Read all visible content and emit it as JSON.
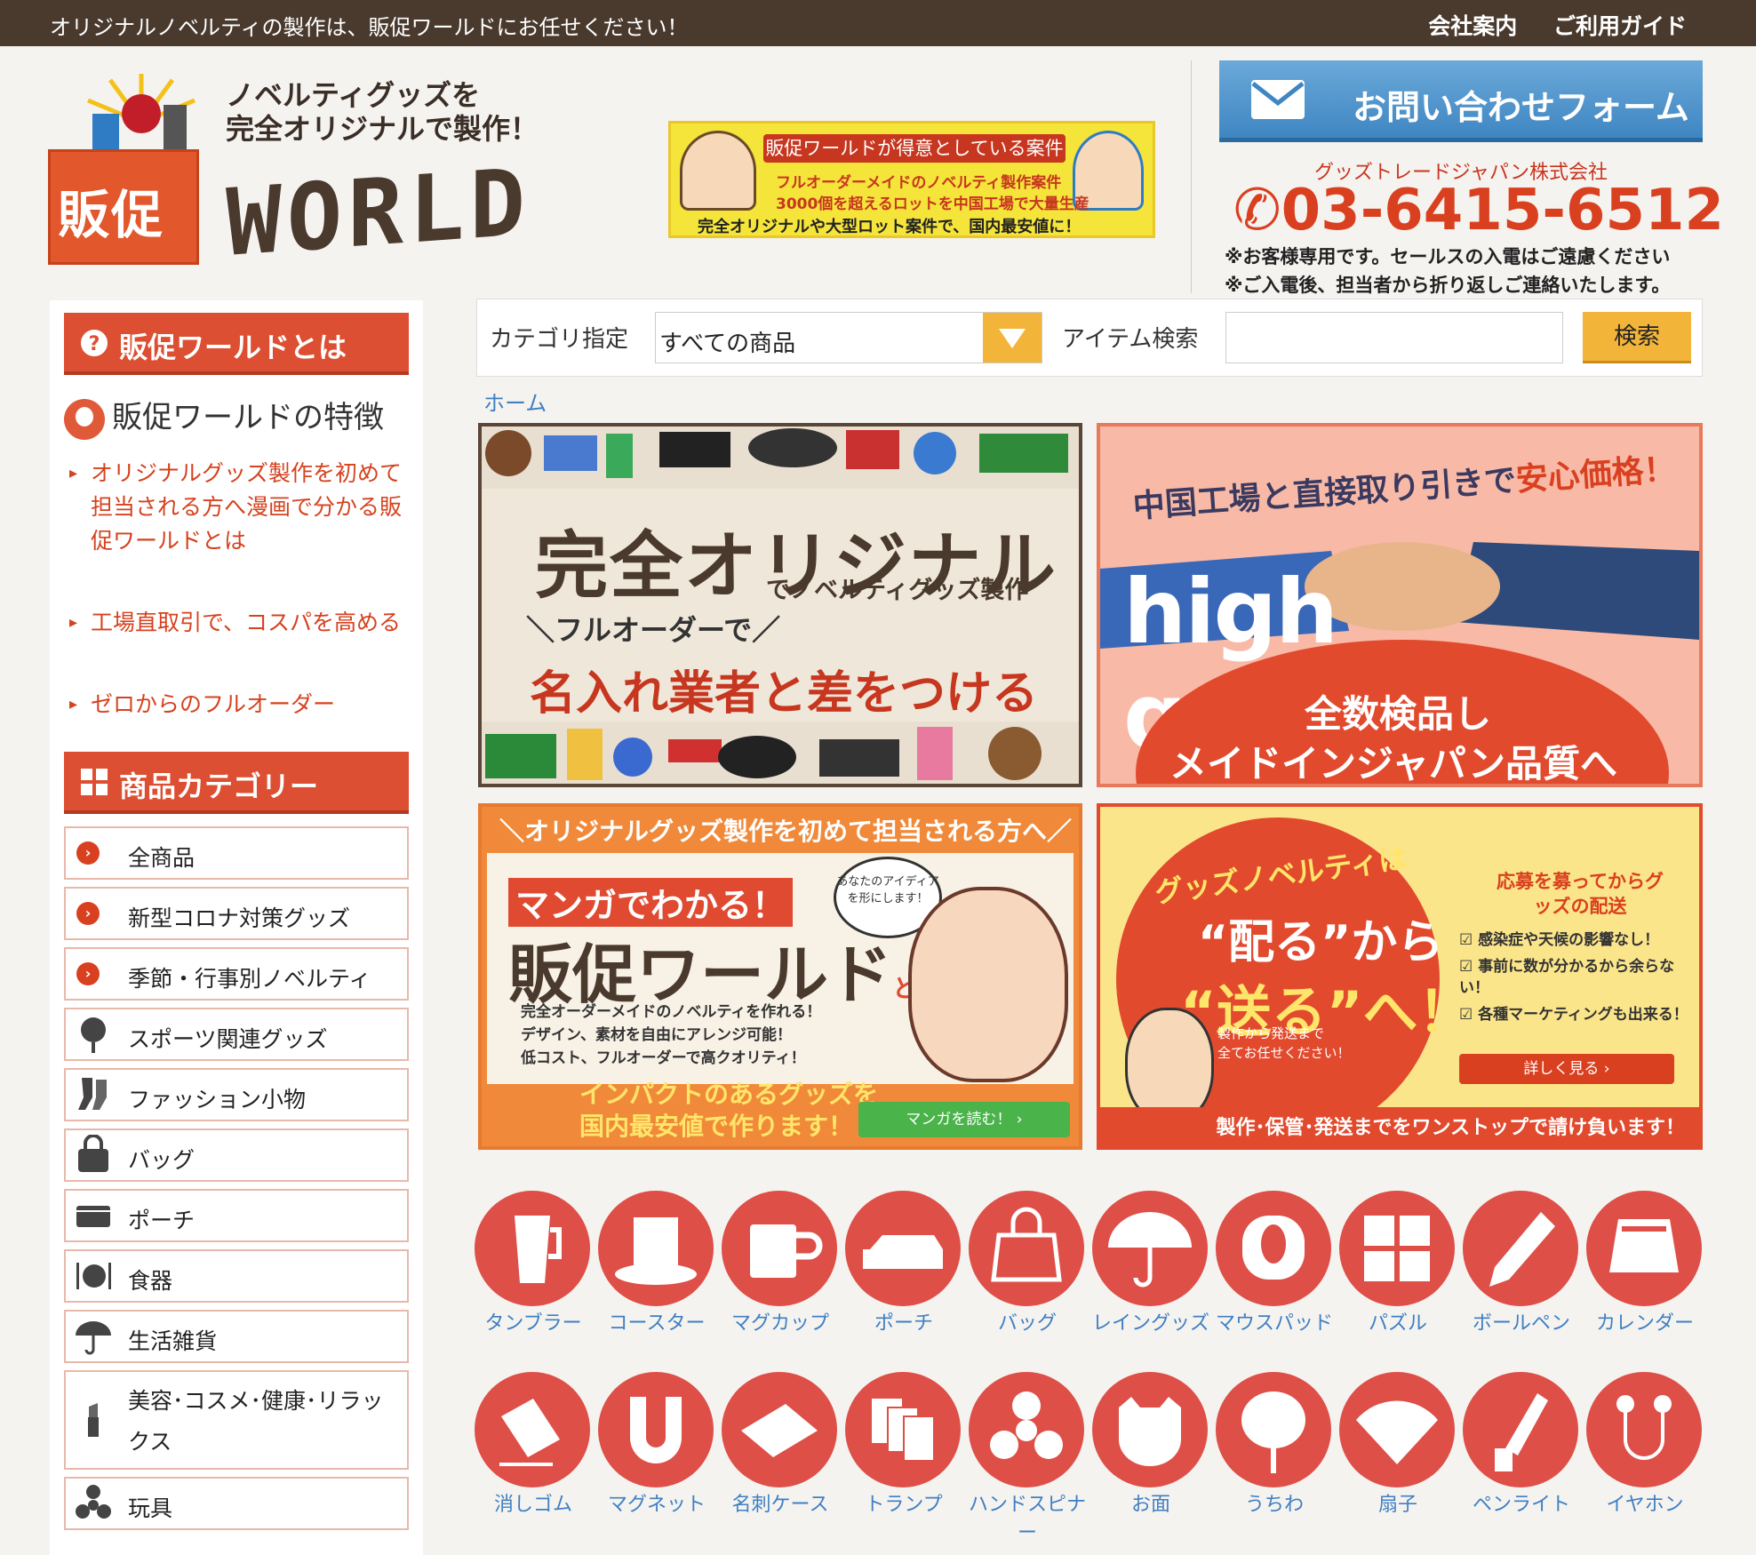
{
  "topbar": {
    "tagline": "オリジナルノベルティの製作は、販促ワールドにお任せください！",
    "links": [
      "会社案内",
      "ご利用ガイド"
    ]
  },
  "logo": {
    "kanji": "販促",
    "tagline1": "ノベルティグッズを",
    "tagline2": "完全オリジナルで製作！",
    "world": "WORLD"
  },
  "promo": {
    "title": "販促ワールドが得意としている案件",
    "line1": "フルオーダーメイドのノベルティ製作案件",
    "line2": "3000個を超えるロットを中国工場で大量生産",
    "line3": "完全オリジナルや大型ロット案件で、国内最安値に！"
  },
  "contact": {
    "button": "お問い合わせフォーム",
    "company": "グッズトレードジャパン株式会社",
    "phone": "03-6415-6512",
    "note1": "※お客様専用です。セールスの入電はご遠慮ください",
    "note2": "※ご入電後、担当者から折り返しご連絡いたします。"
  },
  "sidebar": {
    "about_heading": "販促ワールドとは",
    "features_title": "販促ワールドの特徴",
    "feature_links": [
      "オリジナルグッズ製作を初めて担当される方へ漫画で分かる販促ワールドとは",
      "工場直取引で、コスパを高める",
      "ゼロからのフルオーダー"
    ],
    "category_heading": "商品カテゴリー",
    "categories": [
      "全商品",
      "新型コロナ対策グッズ",
      "季節・行事別ノベルティ",
      "スポーツ関連グッズ",
      "ファッション小物",
      "バッグ",
      "ポーチ",
      "食器",
      "生活雑貨",
      "美容･コスメ･健康･リラックス",
      "玩具"
    ]
  },
  "search": {
    "category_label": "カテゴリ指定",
    "category_value": "すべての商品",
    "item_label": "アイテム検索",
    "item_value": "",
    "button": "検索"
  },
  "breadcrumb": "ホーム",
  "banners": {
    "b1": {
      "big": "完全オリジナル",
      "sub": "でノベルティグッズ製作",
      "line3": "＼フルオーダーで／",
      "line4": "名入れ業者と差をつける"
    },
    "b2": {
      "top_a": "中国工場と直接取り引きで",
      "top_b": "安心価格！",
      "hq": "high quality",
      "d1": "全数検品し",
      "d2": "メイドインジャパン品質へ"
    },
    "b3": {
      "head": "＼オリジナルグッズ製作を初めて担当される方へ／",
      "m1": "マンガでわかる！",
      "m2": "販促ワールド",
      "m2_suffix": "とは",
      "bubble": "あなたのアイディアを形にします！",
      "points": [
        "完全オーダーメイドのノベルティを作れる！",
        "デザイン、素材を自由にアレンジ可能！",
        "低コスト、フルオーダーで高クオリティ！"
      ],
      "bottom1": "インパクトのあるグッズを",
      "bottom2": "国内最安値で作ります！",
      "read": "マンガを読む！ ›"
    },
    "b4": {
      "c1": "グッズノベルティは",
      "c2": "“配る”から",
      "c3": "“送る”へ！",
      "c4a": "製作から発送まで",
      "c4b": "全てお任せください！",
      "r1": "応募を募ってからグッズの配送",
      "checks": [
        "感染症や天候の影響なし！",
        "事前に数が分かるから余らない！",
        "各種マーケティングも出来る！"
      ],
      "more": "詳しく見る ›",
      "foot": "製作･保管･発送までをワンストップで請け負います！"
    }
  },
  "items_row1": [
    "タンブラー",
    "コースター",
    "マグカップ",
    "ポーチ",
    "バッグ",
    "レイングッズ",
    "マウスパッド",
    "パズル",
    "ボールペン",
    "カレンダー"
  ],
  "items_row2": [
    "消しゴム",
    "マグネット",
    "名刺ケース",
    "トランプ",
    "ハンドスピナー",
    "お面",
    "うちわ",
    "扇子",
    "ペンライト",
    "イヤホン"
  ],
  "colors": {
    "brand_red": "#de4f48",
    "brand_brown": "#4a3a2e",
    "link_blue": "#3f7fc2",
    "accent_yellow": "#f2b53a"
  }
}
